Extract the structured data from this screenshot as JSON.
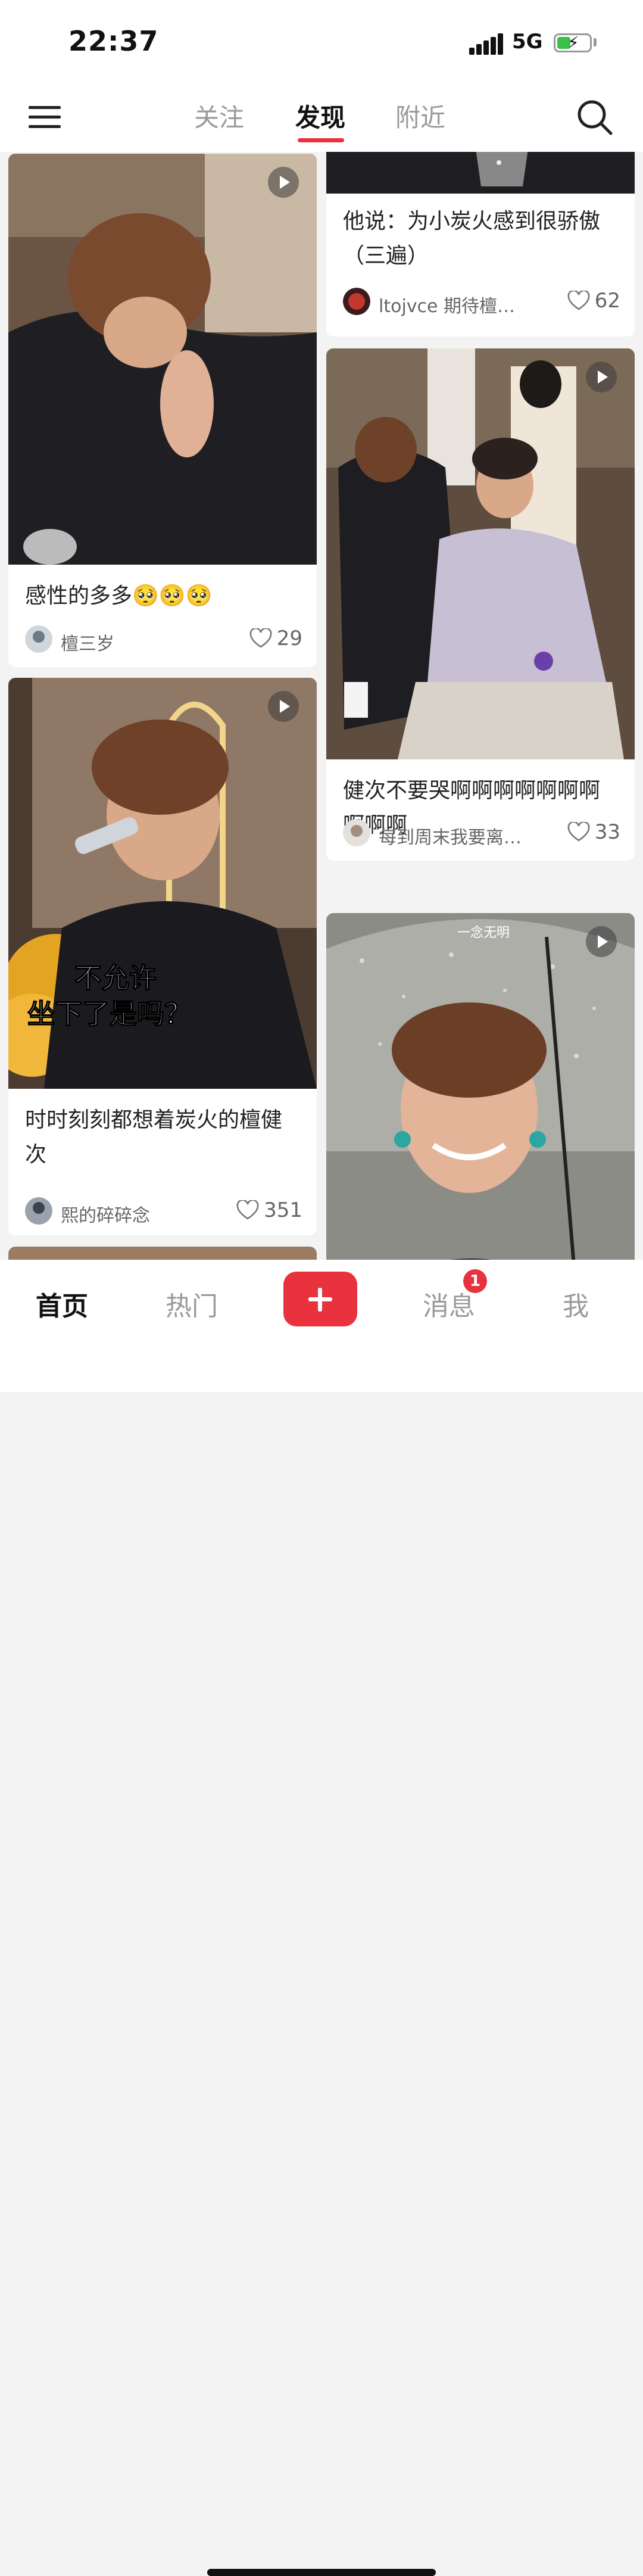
{
  "status": {
    "time": "22:37",
    "network": "5G"
  },
  "topnav": {
    "tabs": [
      {
        "label": "关注"
      },
      {
        "label": "发现"
      },
      {
        "label": "附近"
      }
    ]
  },
  "feed": {
    "left": [
      {
        "title": "感性的多多🥺🥺🥺",
        "author": "檀三岁",
        "likes": "29"
      },
      {
        "title": "时时刻刻都想着炭火的檀健次",
        "author": "熙的碎碎念",
        "likes": "351",
        "overlay_caption": "不允许\n坐下了是吗？"
      }
    ],
    "right": [
      {
        "title": "他说：为小炭火感到很骄傲（三遍）",
        "author": "ltojvce 期待檀健…",
        "likes": "62"
      },
      {
        "title": "健次不要哭啊啊啊啊啊啊啊啊啊啊",
        "author": "每到周末我要离…",
        "likes": "33"
      },
      {
        "watermark": "一念无明"
      }
    ]
  },
  "bottombar": {
    "tabs": [
      {
        "label": "首页"
      },
      {
        "label": "热门"
      },
      {
        "label": "消息"
      },
      {
        "label": "我"
      }
    ],
    "message_badge": "1"
  },
  "colors": {
    "accent": "#e8333e",
    "battery": "#38c24a"
  }
}
